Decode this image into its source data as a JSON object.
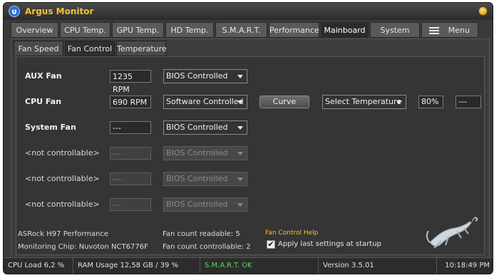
{
  "window": {
    "title": "Argus Monitor"
  },
  "main_tabs": [
    {
      "label": "Overview"
    },
    {
      "label": "CPU Temp."
    },
    {
      "label": "GPU Temp."
    },
    {
      "label": "HD Temp."
    },
    {
      "label": "S.M.A.R.T."
    },
    {
      "label": "Performance"
    },
    {
      "label": "Mainboard",
      "active": true
    },
    {
      "label": "System"
    },
    {
      "label": "Menu"
    }
  ],
  "sub_tabs": [
    {
      "label": "Fan Speed"
    },
    {
      "label": "Fan Control",
      "active": true
    },
    {
      "label": "Temperature"
    }
  ],
  "fans": [
    {
      "label": "AUX Fan",
      "rpm": "1235 RPM",
      "mode": "BIOS Controlled",
      "controllable": true
    },
    {
      "label": "CPU Fan",
      "rpm": "690 RPM",
      "mode": "Software Controlled",
      "controllable": true
    },
    {
      "label": "System Fan",
      "rpm": "---",
      "mode": "BIOS Controlled",
      "controllable": true
    },
    {
      "label": "<not controllable>",
      "rpm": "---",
      "mode": "BIOS Controlled",
      "controllable": false
    },
    {
      "label": "<not controllable>",
      "rpm": "---",
      "mode": "BIOS Controlled",
      "controllable": false
    },
    {
      "label": "<not controllable>",
      "rpm": "---",
      "mode": "BIOS Controlled",
      "controllable": false
    }
  ],
  "cpu_fan_controls": {
    "curve_label": "Curve",
    "temperature_select": "Select Temperature",
    "percent": "80%",
    "extra": "---"
  },
  "info": {
    "board": "ASRock H97 Performance",
    "chip": "Monitoring Chip: Nuvoton NCT6776F",
    "fan_readable": "Fan count readable: 5",
    "fan_controllable": "Fan count controllable: 2",
    "help_link": "Fan Control Help",
    "apply_label": "Apply last settings at startup",
    "apply_checked": true
  },
  "status": {
    "cpu_load": "CPU Load 6,2 %",
    "ram": "RAM Usage 12,58 GB / 39 %",
    "smart": "S.M.A.R.T. OK",
    "version": "Version 3.5.01",
    "time": "10:18:49 PM"
  },
  "icons": {
    "app": "argus-logo-icon",
    "close": "close-icon",
    "menu": "hamburger-menu-icon",
    "dropdown": "chevron-down-icon",
    "mascot": "gecko-logo"
  },
  "colors": {
    "title": "#f4c430",
    "ok": "#5ed85e",
    "help_link": "#f4c430"
  }
}
